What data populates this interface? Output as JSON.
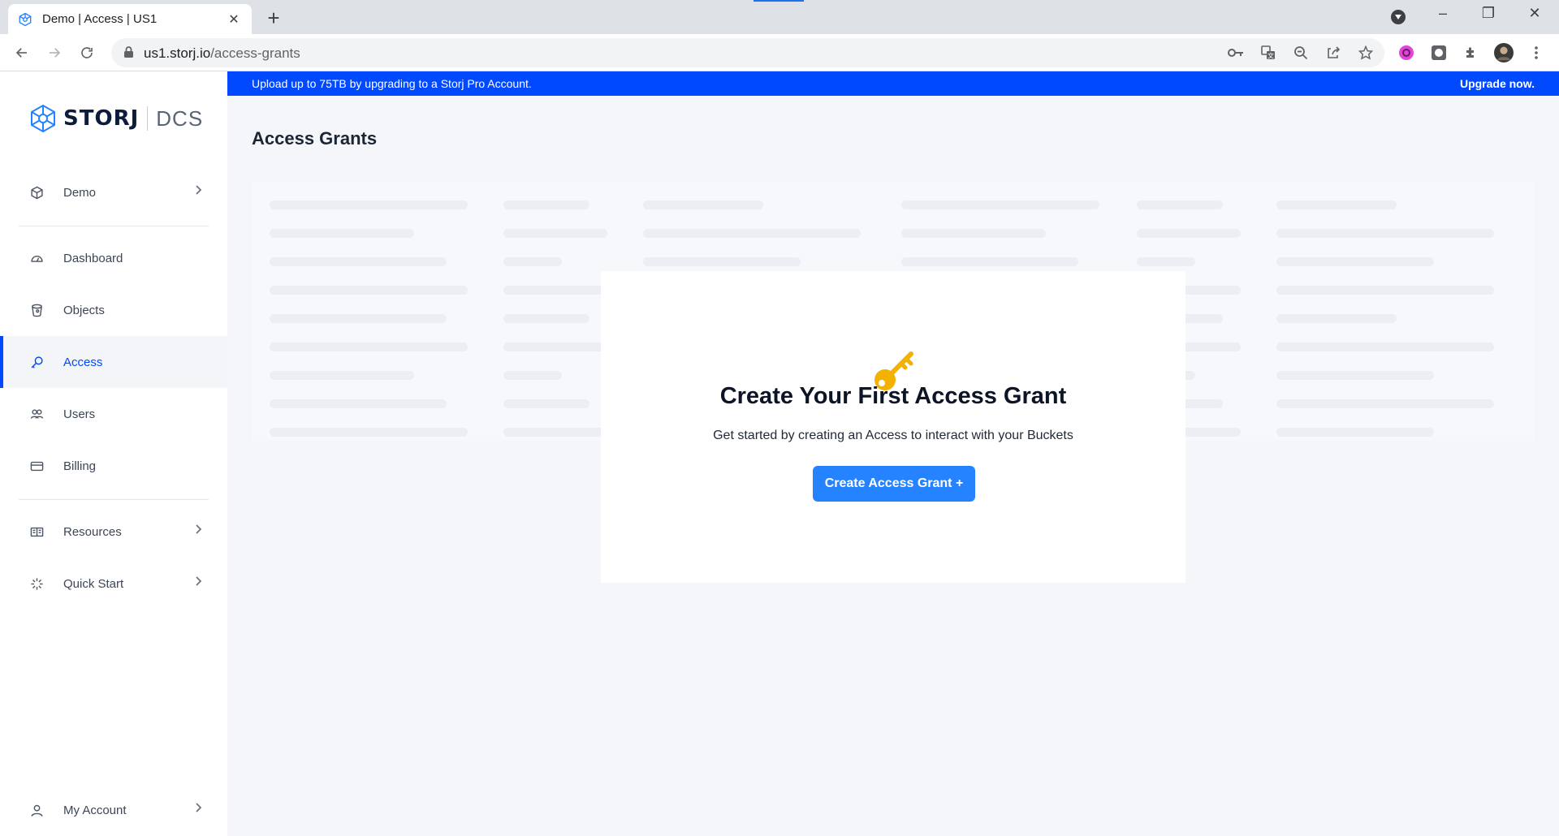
{
  "browser": {
    "tab_title": "Demo | Access | US1",
    "tab_close": "✕",
    "new_tab": "+",
    "url_host": "us1.storj.io",
    "url_path": "/access-grants",
    "win_minimize": "–",
    "win_restore": "❐",
    "win_close": "✕"
  },
  "brand": {
    "name": "STORJ",
    "product": "DCS",
    "accent_color": "#0149ff"
  },
  "sidebar": {
    "project": {
      "label": "Demo",
      "icon": "cube-icon"
    },
    "items": [
      {
        "label": "Dashboard",
        "icon": "gauge-icon"
      },
      {
        "label": "Objects",
        "icon": "bucket-icon"
      },
      {
        "label": "Access",
        "icon": "key-icon",
        "active": true
      },
      {
        "label": "Users",
        "icon": "users-icon"
      },
      {
        "label": "Billing",
        "icon": "card-icon"
      }
    ],
    "secondary": [
      {
        "label": "Resources",
        "icon": "book-icon"
      },
      {
        "label": "Quick Start",
        "icon": "sparkle-icon"
      }
    ],
    "account": {
      "label": "My Account",
      "icon": "user-icon"
    }
  },
  "banner": {
    "text": "Upload up to 75TB by upgrading to a Storj Pro Account.",
    "link": "Upgrade now."
  },
  "page": {
    "title": "Access Grants"
  },
  "empty_state": {
    "title": "Create Your First Access Grant",
    "subtitle": "Get started by creating an Access to interact with your Buckets",
    "button": "Create Access Grant +"
  }
}
